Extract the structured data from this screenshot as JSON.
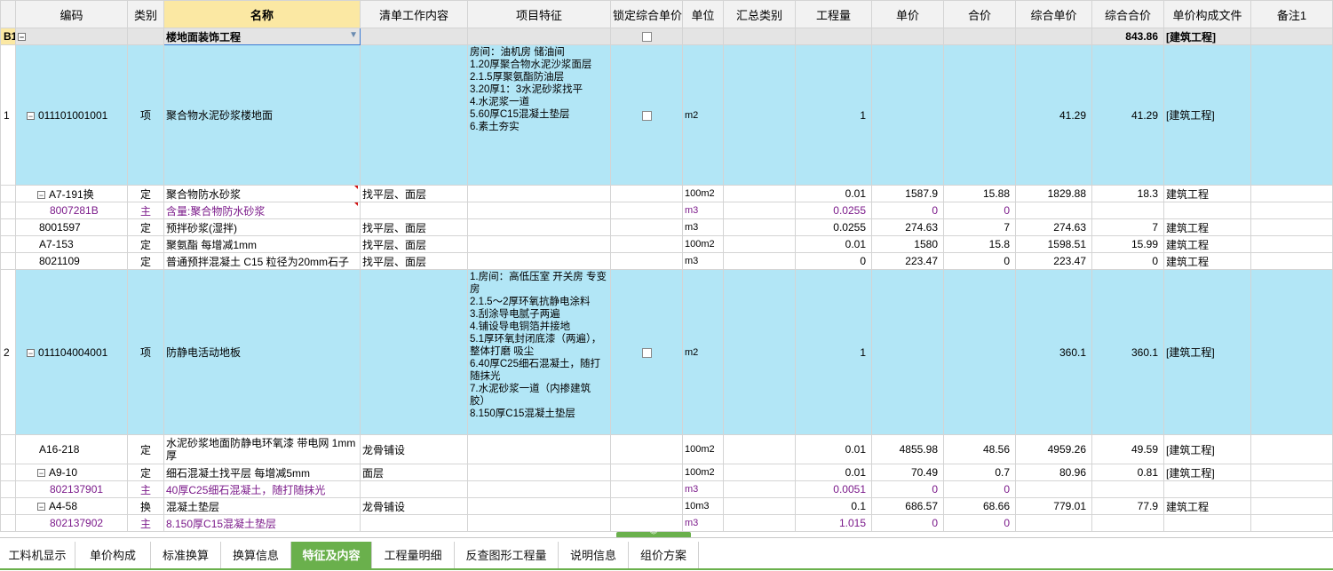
{
  "headers": [
    "",
    "编码",
    "类别",
    "名称",
    "清单工作内容",
    "项目特征",
    "锁定综合单价",
    "单位",
    "汇总类别",
    "工程量",
    "单价",
    "合价",
    "综合单价",
    "综合合价",
    "单价构成文件",
    "备注1"
  ],
  "section": {
    "idx": "B1",
    "name": "楼地面装饰工程",
    "total": "843.86",
    "file": "[建筑工程]"
  },
  "rows": [
    {
      "idx": "1",
      "code": "011101001001",
      "type": "项",
      "name": "聚合物水泥砂浆楼地面",
      "work": "",
      "feature": "房间：油机房 储油间\n1.20厚聚合物水泥沙浆面层\n2.1.5厚聚氨酯防油层\n3.20厚1：3水泥砂浆找平\n4.水泥浆一道\n5.60厚C15混凝土垫层\n6.素土夯实",
      "unit": "m2",
      "qty": "1",
      "price": "",
      "amount": "",
      "cprice": "41.29",
      "camount": "41.29",
      "file": "[建筑工程]"
    },
    {
      "idx": "",
      "code": "A7-191换",
      "type": "定",
      "name": "聚合物防水砂浆",
      "work": "找平层、面层",
      "unit": "100m2",
      "qty": "0.01",
      "price": "1587.9",
      "amount": "15.88",
      "cprice": "1829.88",
      "camount": "18.3",
      "file": "建筑工程"
    },
    {
      "idx": "",
      "code": "8007281B",
      "type": "主",
      "name": "含量:聚合物防水砂浆",
      "work": "",
      "unit": "m3",
      "qty": "0.0255",
      "price": "0",
      "amount": "0",
      "cprice": "",
      "camount": "",
      "file": ""
    },
    {
      "idx": "",
      "code": "8001597",
      "type": "定",
      "name": "预拌砂浆(湿拌)",
      "work": "找平层、面层",
      "unit": "m3",
      "qty": "0.0255",
      "price": "274.63",
      "amount": "7",
      "cprice": "274.63",
      "camount": "7",
      "file": "建筑工程"
    },
    {
      "idx": "",
      "code": "A7-153",
      "type": "定",
      "name": "聚氨酯 每增减1mm",
      "work": "找平层、面层",
      "unit": "100m2",
      "qty": "0.01",
      "price": "1580",
      "amount": "15.8",
      "cprice": "1598.51",
      "camount": "15.99",
      "file": "建筑工程"
    },
    {
      "idx": "",
      "code": "8021109",
      "type": "定",
      "name": "普通预拌混凝土 C15 粒径为20mm石子",
      "work": "找平层、面层",
      "unit": "m3",
      "qty": "0",
      "price": "223.47",
      "amount": "0",
      "cprice": "223.47",
      "camount": "0",
      "file": "建筑工程"
    },
    {
      "idx": "2",
      "code": "011104004001",
      "type": "项",
      "name": "防静电活动地板",
      "work": "",
      "feature": "1.房间：高低压室 开关房 专变房\n2.1.5～2厚环氧抗静电涂料\n3.刮涂导电腻子两遍\n4.铺设导电铜箔并接地\n5.1厚环氧封闭底漆（两遍），整体打磨 吸尘\n6.40厚C25细石混凝土，随打随抹光\n7.水泥砂浆一道（内掺建筑胶）\n8.150厚C15混凝土垫层",
      "unit": "m2",
      "qty": "1",
      "price": "",
      "amount": "",
      "cprice": "360.1",
      "camount": "360.1",
      "file": "[建筑工程]"
    },
    {
      "idx": "",
      "code": "A16-218",
      "type": "定",
      "name": "水泥砂浆地面防静电环氧漆 带电网 1mm厚",
      "work": "龙骨铺设",
      "unit": "100m2",
      "qty": "0.01",
      "price": "4855.98",
      "amount": "48.56",
      "cprice": "4959.26",
      "camount": "49.59",
      "file": "[建筑工程]"
    },
    {
      "idx": "",
      "code": "A9-10",
      "type": "定",
      "name": "细石混凝土找平层 每增减5mm",
      "work": "面层",
      "unit": "100m2",
      "qty": "0.01",
      "price": "70.49",
      "amount": "0.7",
      "cprice": "80.96",
      "camount": "0.81",
      "file": "[建筑工程]"
    },
    {
      "idx": "",
      "code": "802137901",
      "type": "主",
      "name": "40厚C25细石混凝土，随打随抹光",
      "work": "",
      "unit": "m3",
      "qty": "0.0051",
      "price": "0",
      "amount": "0",
      "cprice": "",
      "camount": "",
      "file": ""
    },
    {
      "idx": "",
      "code": "A4-58",
      "type": "换",
      "name": "混凝土垫层",
      "work": "龙骨铺设",
      "unit": "10m3",
      "qty": "0.1",
      "price": "686.57",
      "amount": "68.66",
      "cprice": "779.01",
      "camount": "77.9",
      "file": "建筑工程"
    },
    {
      "idx": "",
      "code": "802137902",
      "type": "主",
      "name": "8.150厚C15混凝土垫层",
      "work": "",
      "unit": "m3",
      "qty": "1.015",
      "price": "0",
      "amount": "0",
      "cprice": "",
      "camount": "",
      "file": ""
    }
  ],
  "tabs": [
    "工料机显示",
    "单价构成",
    "标准换算",
    "换算信息",
    "特征及内容",
    "工程量明细",
    "反查图形工程量",
    "说明信息",
    "组价方案"
  ],
  "active_tab": "特征及内容",
  "colors": {
    "accent": "#6ab04c",
    "highlight_row": "#b2e6f6",
    "main_material_text": "#7b1a8a"
  }
}
